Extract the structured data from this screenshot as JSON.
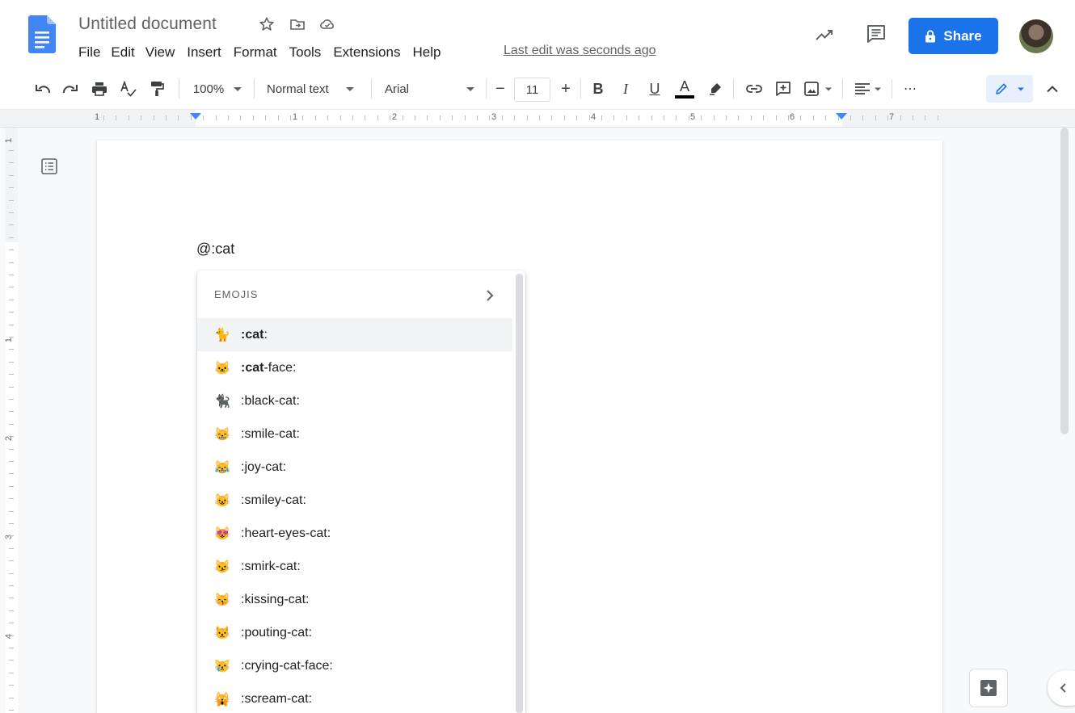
{
  "document": {
    "title": "Untitled document",
    "last_edit": "Last edit was seconds ago",
    "body_text": "@:cat"
  },
  "menu": [
    "File",
    "Edit",
    "View",
    "Insert",
    "Format",
    "Tools",
    "Extensions",
    "Help"
  ],
  "header": {
    "share_label": "Share",
    "icons": [
      "star-icon",
      "move-to-folder-icon",
      "cloud-saved-icon",
      "activity-trend-icon",
      "comments-icon",
      "lock-icon",
      "account-avatar"
    ]
  },
  "toolbar": {
    "zoom": "100%",
    "style": "Normal text",
    "font": "Arial",
    "font_size": "11",
    "minus": "−",
    "plus": "+",
    "bold": "B",
    "italic": "I",
    "underline": "U",
    "text_color": "A",
    "more": "⋯",
    "icons": [
      "undo-icon",
      "redo-icon",
      "print-icon",
      "spellcheck-icon",
      "paint-format-icon",
      "highlight-icon",
      "link-icon",
      "add-comment-icon",
      "insert-image-icon",
      "align-icon",
      "editing-mode-icon",
      "collapse-icon"
    ]
  },
  "ruler": {
    "labels": [
      "1",
      "1",
      "2",
      "3",
      "4",
      "5",
      "6",
      "7"
    ],
    "vertical_labels": [
      "1",
      "1",
      "2",
      "3",
      "4"
    ]
  },
  "popup": {
    "header": "EMOJIS",
    "items": [
      {
        "emoji": "🐈",
        "query": ":cat",
        "rest": ":",
        "selected": true
      },
      {
        "emoji": "🐱",
        "query": ":cat",
        "rest": "-face:",
        "selected": false
      },
      {
        "emoji": "🐈‍⬛",
        "query": "",
        "rest": ":black-cat:",
        "selected": false
      },
      {
        "emoji": "😸",
        "query": "",
        "rest": ":smile-cat:",
        "selected": false
      },
      {
        "emoji": "😹",
        "query": "",
        "rest": ":joy-cat:",
        "selected": false
      },
      {
        "emoji": "😺",
        "query": "",
        "rest": ":smiley-cat:",
        "selected": false
      },
      {
        "emoji": "😻",
        "query": "",
        "rest": ":heart-eyes-cat:",
        "selected": false
      },
      {
        "emoji": "😼",
        "query": "",
        "rest": ":smirk-cat:",
        "selected": false
      },
      {
        "emoji": "😽",
        "query": "",
        "rest": ":kissing-cat:",
        "selected": false
      },
      {
        "emoji": "😾",
        "query": "",
        "rest": ":pouting-cat:",
        "selected": false
      },
      {
        "emoji": "😿",
        "query": "",
        "rest": ":crying-cat-face:",
        "selected": false
      },
      {
        "emoji": "🙀",
        "query": "",
        "rest": ":scream-cat:",
        "selected": false
      }
    ]
  },
  "colors": {
    "accent": "#1a73e8",
    "docs_blue": "#4285f4",
    "text": "#202124",
    "muted": "#5f6368"
  }
}
